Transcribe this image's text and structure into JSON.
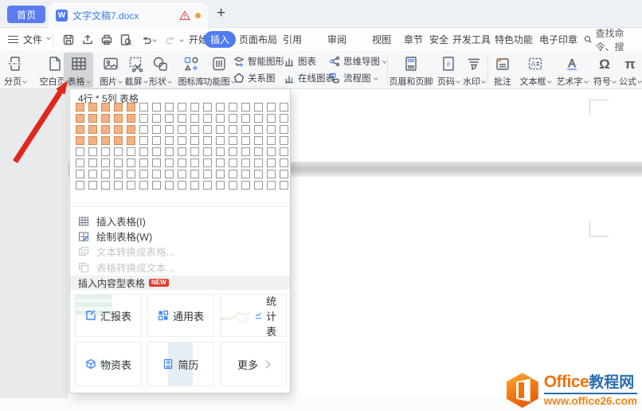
{
  "colors": {
    "accent_blue": "#4e7cf0",
    "selection_orange": "#f4b183",
    "arrow_red": "#e0271d",
    "brand_orange": "#ee7211",
    "brand_blue": "#2a6db0",
    "badge_red": "#e23c30"
  },
  "tabbar": {
    "home": "首页",
    "doc_icon": "W",
    "doc_name": "文字文稿7.docx",
    "new_tab": "+"
  },
  "menubar": {
    "file_label": "文件",
    "tabs": [
      "开始",
      "插入",
      "页面布局",
      "引用",
      "审阅",
      "视图",
      "章节",
      "安全",
      "开发工具",
      "特色功能",
      "电子印章"
    ],
    "active_tab": "插入",
    "search_text": "查找命令、搜"
  },
  "ribbon": {
    "big_buttons": [
      {
        "label": "分页"
      },
      {
        "label": "空白页"
      },
      {
        "label": "表格"
      },
      {
        "label": "图片"
      },
      {
        "label": "截屏"
      },
      {
        "label": "形状"
      },
      {
        "label": "图标库"
      },
      {
        "label": "功能图"
      }
    ],
    "small_buttons": [
      {
        "label": "智能图形"
      },
      {
        "label": "图表"
      },
      {
        "label": "思维导图"
      },
      {
        "label": "关系图"
      },
      {
        "label": "在线图表"
      },
      {
        "label": "流程图"
      }
    ],
    "right_buttons": [
      {
        "label": "页眉和页脚"
      },
      {
        "label": "页码"
      },
      {
        "label": "水印"
      },
      {
        "label": "批注"
      },
      {
        "label": "文本框"
      },
      {
        "label": "艺术字"
      },
      {
        "label": "符号"
      },
      {
        "label": "公式"
      }
    ],
    "symbol_glyph": "Ω",
    "formula_glyph": "π",
    "pagenum_glyph": "#"
  },
  "table_dropdown": {
    "grid_label": "4行 * 5列 表格",
    "grid": {
      "cols": 17,
      "rows": 8,
      "selected_cols": 5,
      "selected_rows": 4
    },
    "menu_items": [
      {
        "label": "插入表格(I)",
        "disabled": false
      },
      {
        "label": "绘制表格(W)",
        "disabled": false
      },
      {
        "label": "文本转换成表格...",
        "disabled": true
      },
      {
        "label": "表格转换成文本...",
        "disabled": true
      }
    ],
    "section_title": "插入内容型表格",
    "section_badge": "NEW",
    "tiles": [
      {
        "label": "汇报表"
      },
      {
        "label": "通用表"
      },
      {
        "label": "统计表"
      },
      {
        "label": "物资表"
      },
      {
        "label": "简历"
      },
      {
        "label": "更多"
      }
    ]
  },
  "watermark": {
    "brand_first": "Office",
    "brand_second": "教程网",
    "url": "www.office26.com"
  }
}
